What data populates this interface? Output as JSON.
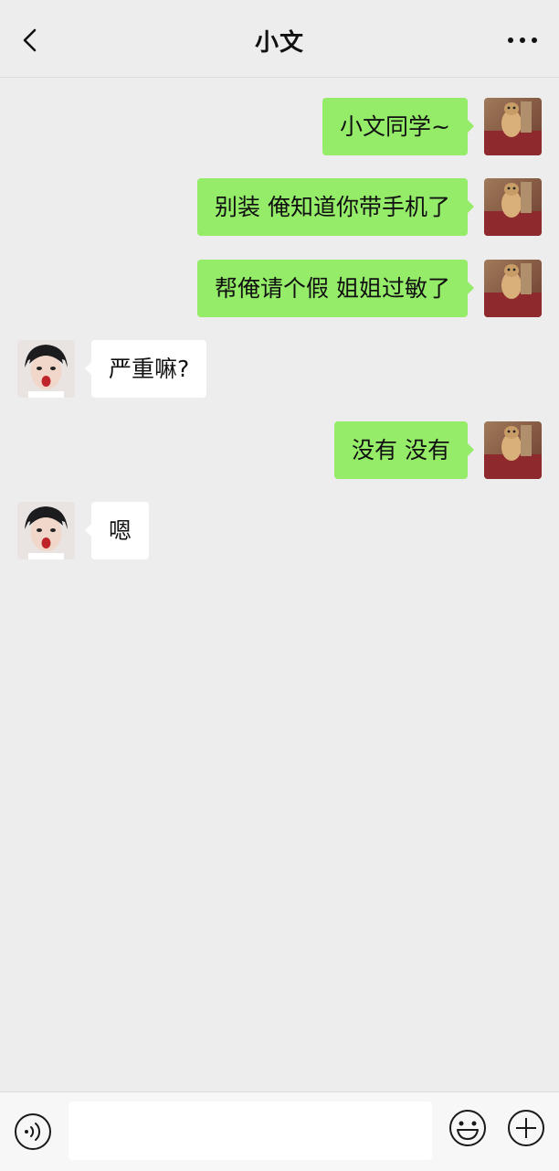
{
  "header": {
    "title": "小文",
    "back_icon": "chevron-left-icon",
    "more_icon": "more-dots-icon"
  },
  "messages": [
    {
      "side": "out",
      "text": "小文同学~"
    },
    {
      "side": "out",
      "text": "别装 俺知道你带手机了"
    },
    {
      "side": "out",
      "text": "帮俺请个假 姐姐过敏了"
    },
    {
      "side": "in",
      "text": "严重嘛?"
    },
    {
      "side": "out",
      "text": "没有 没有"
    },
    {
      "side": "in",
      "text": "嗯"
    }
  ],
  "input_bar": {
    "voice_icon": "voice-icon",
    "input_value": "",
    "emoji_icon": "emoji-icon",
    "plus_icon": "plus-circle-icon"
  },
  "colors": {
    "background": "#ededed",
    "outgoing_bubble": "#95ec69",
    "incoming_bubble": "#ffffff"
  }
}
